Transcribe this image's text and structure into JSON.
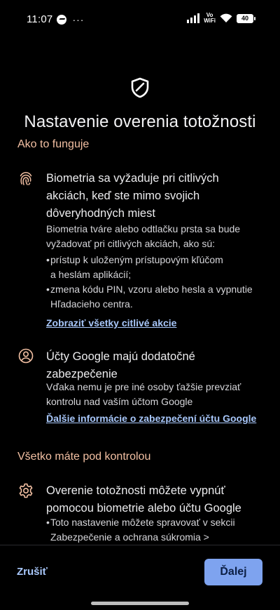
{
  "status_bar": {
    "time": "11:07",
    "more_indicator": "···",
    "vowifi_top": "Vo",
    "vowifi_bottom": "WiFi",
    "battery_level": "40"
  },
  "header": {
    "icon": "shield-icon",
    "title": "Nastavenie overenia totožnosti"
  },
  "how_it_works": {
    "label": "Ako to funguje",
    "biometrics": {
      "icon": "fingerprint-icon",
      "title": "Biometria sa vyžaduje pri citlivých akciách, keď ste mimo svojich dôveryhodných miest",
      "description": "Biometria tváre alebo odtlačku prsta sa bude vyžadovať pri citlivých akciách, ako sú:",
      "bullets": [
        {
          "line1": "prístup k uloženým prístupovým kľúčom",
          "line2": "a heslám aplikácií;"
        },
        {
          "line1": "zmena kódu PIN, vzoru alebo hesla a vypnutie",
          "line2": "Hľadacieho centra."
        }
      ],
      "link": "Zobraziť všetky citlivé akcie"
    },
    "google_accounts": {
      "icon": "account-circle-icon",
      "title": "Účty Google majú dodatočné zabezpečenie",
      "description": "Vďaka nemu je pre iné osoby ťažšie prevziať kontrolu nad vaším účtom Google",
      "link": "Ďalšie informácie o zabezpečení účtu Google"
    }
  },
  "control": {
    "label": "Všetko máte pod kontrolou",
    "settings": {
      "icon": "gear-icon",
      "title": "Overenie totožnosti môžete vypnúť pomocou biometrie alebo účtu Google",
      "bullet_line1": "Toto nastavenie môžete spravovať v sekcii",
      "bullet_line2": "Zabezpečenie a ochrana súkromia >"
    }
  },
  "footer": {
    "cancel_label": "Zrušiť",
    "next_label": "Ďalej"
  },
  "colors": {
    "background": "#000000",
    "accent_label": "#f3c0a3",
    "link": "#a8c7fa",
    "primary_button": "#7ea3ef"
  }
}
